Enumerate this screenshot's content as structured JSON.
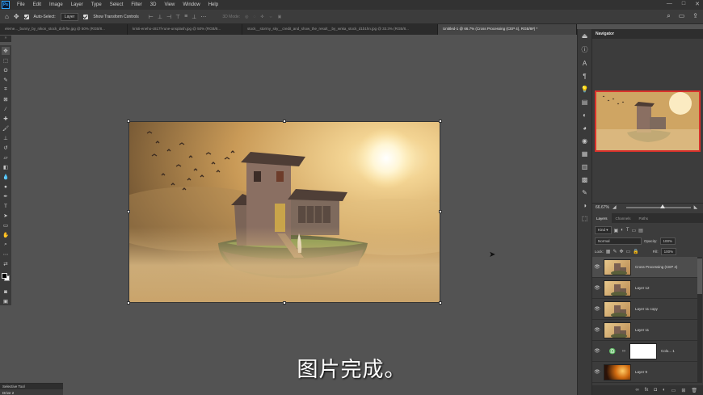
{
  "menubar": {
    "logo": "Ps",
    "items": [
      "File",
      "Edit",
      "Image",
      "Layer",
      "Type",
      "Select",
      "Filter",
      "3D",
      "View",
      "Window",
      "Help"
    ]
  },
  "options": {
    "auto_select_label": "Auto-Select:",
    "auto_select_value": "Layer",
    "transform_label": "Show Transform Controls",
    "mode_3d": "3D Mode:"
  },
  "tabs": [
    {
      "label": "eleme..._bunny_by_nikon_stock_dolt-fte.jpg @ 50% (RGB/8...",
      "active": false
    },
    {
      "label": "kristi-eneho-c817f-rune-unsplash.jpg @ 50% (RGB/8...",
      "active": false
    },
    {
      "label": "stock__stormy_sky__credit_and_show_the_result__by_wnka_stock_d1b1hn.jpg @ 33.3% (RGB/8...",
      "active": false
    },
    {
      "label": "Untitled-1 @ 66.7% (Cross Processing (CEP 4), RGB/8#) *",
      "active": true
    }
  ],
  "navigator": {
    "title": "Navigator",
    "zoom": "66.67%"
  },
  "layers_panel": {
    "tabs": [
      "Layers",
      "Channels",
      "Paths"
    ],
    "filter_kind": "Kind",
    "blend_mode": "Normal",
    "opacity_label": "Opacity:",
    "opacity_value": "100%",
    "lock_label": "Lock:",
    "fill_label": "Fill:",
    "fill_value": "100%",
    "layers": [
      {
        "name": "Cross Processing (CEP 4)",
        "selected": true
      },
      {
        "name": "Layer 12",
        "selected": false
      },
      {
        "name": "Layer 11 copy",
        "selected": false
      },
      {
        "name": "Layer 11",
        "selected": false
      },
      {
        "name": "Colo... 1",
        "selected": false
      },
      {
        "name": "Layer 9",
        "selected": false
      }
    ]
  },
  "mini_panel": {
    "title": "Selective Tool",
    "item": "Drive 2"
  },
  "subtitle": "图片完成。",
  "colors": {
    "accent_red": "#d9322c",
    "ps_blue": "#31a8ff"
  }
}
